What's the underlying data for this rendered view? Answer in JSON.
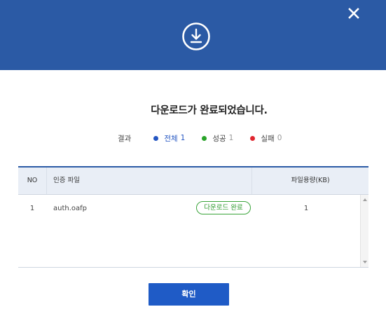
{
  "header": {
    "close_icon": "close-icon",
    "download_icon": "download-circle-icon",
    "color": "#2b5aa5"
  },
  "title": "다운로드가 완료되었습니다.",
  "summary": {
    "label": "결과",
    "total": {
      "label": "전체",
      "count": "1",
      "color": "#2456c2"
    },
    "success": {
      "label": "성공",
      "count": "1",
      "color": "#29a329"
    },
    "fail": {
      "label": "실패",
      "count": "0",
      "color": "#e0262f"
    }
  },
  "table": {
    "headers": {
      "no": "NO",
      "file": "인증 파일",
      "size": "파일용량(KB)"
    },
    "rows": [
      {
        "no": "1",
        "file": "auth.oafp",
        "status": "다운로드 완료",
        "size": "1"
      }
    ]
  },
  "confirm_label": "확인"
}
